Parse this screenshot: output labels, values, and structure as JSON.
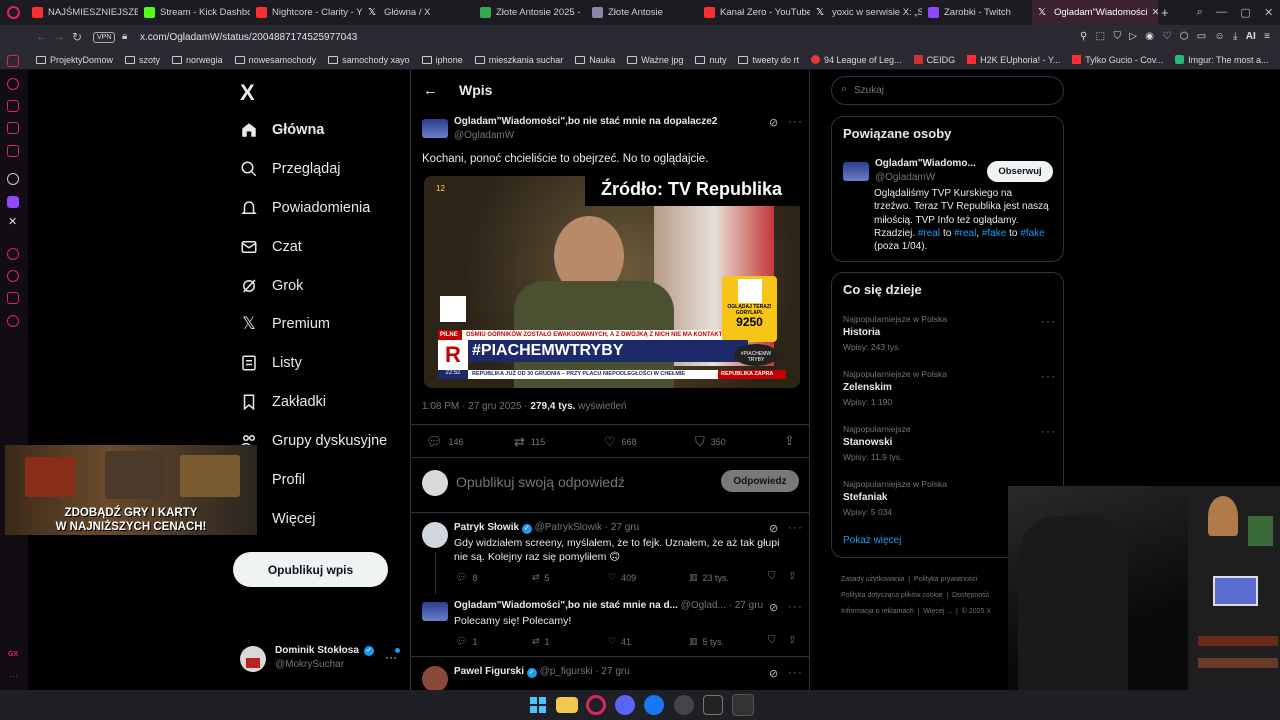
{
  "browser": {
    "tabs": [
      {
        "label": "NAJŚMIESZNIEJSZE M",
        "color": "#ff2d2d"
      },
      {
        "label": "Stream - Kick Dashbo",
        "color": "#53fc18"
      },
      {
        "label": "Nightcore - Clarity - Y",
        "color": "#ff2d2d"
      },
      {
        "label": "Główna / X",
        "color": "#ffffff"
      },
      {
        "label": "Złote Antosie 2025 - ",
        "color": "#34a853"
      },
      {
        "label": "Złote Antosie",
        "color": "#8888aa"
      },
      {
        "label": "Kanał Zero - YouTube",
        "color": "#ff2d2d"
      },
      {
        "label": "yoxic w serwisie X: „S",
        "color": "#ffffff"
      },
      {
        "label": "Zarobki - Twitch",
        "color": "#9146ff"
      },
      {
        "label": "Ogladam\"Wiadomości",
        "color": "#ffffff"
      }
    ],
    "new_tab": "+",
    "vpn": "VPN",
    "url": "x.com/OgladamW/status/2004887174525977043",
    "ai_label": "AI",
    "bookmarks": [
      "ProjektyDomow",
      "szoty",
      "norwegia",
      "nowesamochody",
      "samochody xayo",
      "iphone",
      "mieszkania suchar",
      "Nauka",
      "Ważne jpg",
      "nuty",
      "tweety do rt",
      "94 League of Leg...",
      "CEIDG",
      "H2K EUphoria! - Y...",
      "Tylko Gucio - Cov...",
      "Imgur: The most a..."
    ]
  },
  "nav": {
    "logo": "X",
    "items": [
      "Główna",
      "Przeglądaj",
      "Powiadomienia",
      "Czat",
      "Grok",
      "Premium",
      "Listy",
      "Zakładki",
      "Grupy dyskusyjne",
      "Profil",
      "Więcej"
    ],
    "post_button": "Opublikuj wpis",
    "account_name": "Dominik Stokłosa",
    "account_handle": "@MokrySuchar"
  },
  "ad": {
    "line1": "ZDOBĄDŹ GRY I KARTY",
    "line2": "W NAJNIŻSZYCH CENACH!"
  },
  "post": {
    "header": "Wpis",
    "author": "Ogladam\"Wiadomości\",bo nie stać mnie na dopalacze2",
    "handle": "@OgladamW",
    "text": "Kochani, ponoć chcieliście to obejrzeć. No to oglądajcie.",
    "media": {
      "overlay": "Źródło: TV Republika",
      "channel_num": "12",
      "breaking_bar": "OŚMIU GÓRNIKÓW ZOSTAŁO EWAKUOWANYCH, A Z DWÓJKĄ Z NICH NIE MA KONTAKTU",
      "breaking_label": "PILNE",
      "hashtag": "#PIACHEMWTRYBY",
      "ticker": "REPUBLIKA JUŻ OD 30 GRUDNIA – PRZY PLACU NIEPODLEGŁOŚCI W CHEŁMIE",
      "ticker_right": "REPUBLIKA ZAPRA",
      "time": "22:52",
      "logo_letter": "R",
      "logo_label": "REPUBLIKA",
      "sub_label": "OGLĄDAJ TERAZ!",
      "sub_channel": "GORYLAPL",
      "sub_count": "9250",
      "badge": "#PIACHEMW TRYBY"
    },
    "time": "1:08 PM · 27 gru 2025 · ",
    "views": "279,4 tys.",
    "views_label": "wyświetleń",
    "replies": "146",
    "reposts": "115",
    "likes": "668",
    "bookmarks": "350",
    "reply_placeholder": "Opublikuj swoją odpowiedź",
    "reply_button": "Odpowiedz"
  },
  "replies": [
    {
      "name": "Patryk Słowik",
      "handle": "@PatrykSlowik",
      "time": "· 27 gru",
      "text": "Gdy widziałem screeny, myślałem, że to fejk. Uznałem, że aż tak głupi nie są. Kolejny raz się pomyliłem 🙃",
      "replies": "8",
      "reposts": "5",
      "likes": "409",
      "views": "23 tys."
    },
    {
      "name": "Ogladam\"Wiadomości\",bo nie stać mnie na d...",
      "handle": "@Oglad...",
      "time": "· 27 gru",
      "text": "Polecamy się! Polecamy!",
      "replies": "1",
      "reposts": "1",
      "likes": "41",
      "views": "5 tys."
    },
    {
      "name": "Pawel Figurski",
      "handle": "@p_figurski",
      "time": "· 27 gru",
      "text": ""
    }
  ],
  "right": {
    "search_placeholder": "Szukaj",
    "related_title": "Powiązane osoby",
    "related_name": "Ogladam\"Wiadomo...",
    "related_handle": "@OgladamW",
    "follow_button": "Obserwuj",
    "bio_lines": [
      "Oglądaliśmy TVP Kurskiego na",
      "trzeźwo. Teraz TV Republika jest naszą",
      "miłością. TVP Info też oglądamy."
    ],
    "bio_r_pre": "Rzadziej. ",
    "bio_tags": [
      "#real",
      "#real",
      "#fake",
      "#fake"
    ],
    "bio_to": "to",
    "bio_comma": ",",
    "bio_end": "(poza 1/04).",
    "trends_title": "Co się dzieje",
    "trends": [
      {
        "meta": "Najpopularniejsze w Polska",
        "name": "Historia",
        "count": "Wpisy: 243 tys."
      },
      {
        "meta": "Najpopularniejsze w Polska",
        "name": "Zelenskim",
        "count": "Wpisy: 1 190"
      },
      {
        "meta": "Najpopularniejsze",
        "name": "Stanowski",
        "count": "Wpisy: 11,9 tys."
      },
      {
        "meta": "Najpopularniejsze w Polska",
        "name": "Stefaniak",
        "count": "Wpisy: 5 034"
      }
    ],
    "show_more": "Pokaż więcej",
    "footer": [
      "Zasady użytkowania",
      "Polityka prywatności",
      "Polityka dotycząca plików cookie",
      "Dostępność",
      "Informacja o reklamach",
      "Więcej ...",
      "© 2025 X"
    ]
  },
  "gx_label": "GX"
}
